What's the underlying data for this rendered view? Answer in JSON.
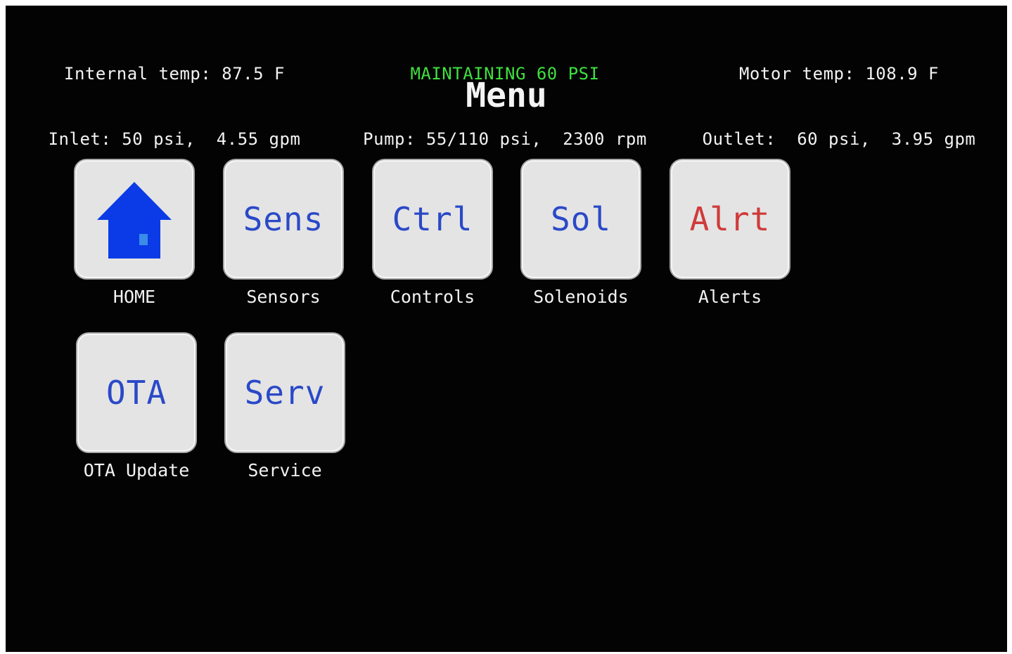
{
  "status": {
    "left": {
      "line1": "Internal temp: 87.5 F",
      "line2": "Inlet: 50 psi,  4.55 gpm"
    },
    "center": {
      "mode": "MAINTAINING 60 PSI",
      "line2": "Pump: 55/110 psi,  2300 rpm"
    },
    "right": {
      "line1": "Motor temp: 108.9 F",
      "line2": "Outlet:  60 psi,  3.95 gpm"
    }
  },
  "title": "Menu",
  "tiles": [
    {
      "icon": "home-icon",
      "text": "",
      "label": "HOME"
    },
    {
      "text": "Sens",
      "label": "Sensors"
    },
    {
      "text": "Ctrl",
      "label": "Controls"
    },
    {
      "text": "Sol",
      "label": "Solenoids"
    },
    {
      "text": "Alrt",
      "label": "Alerts"
    },
    {
      "text": "OTA",
      "label": "OTA Update"
    },
    {
      "text": "Serv",
      "label": "Service"
    }
  ],
  "colors": {
    "background": "#030303",
    "tile": "#e4e4e4",
    "tile_text": "#2a49c8",
    "alert_text": "#d03a3a",
    "mode_text": "#3ee03e",
    "home_icon": "#0a3be6"
  }
}
